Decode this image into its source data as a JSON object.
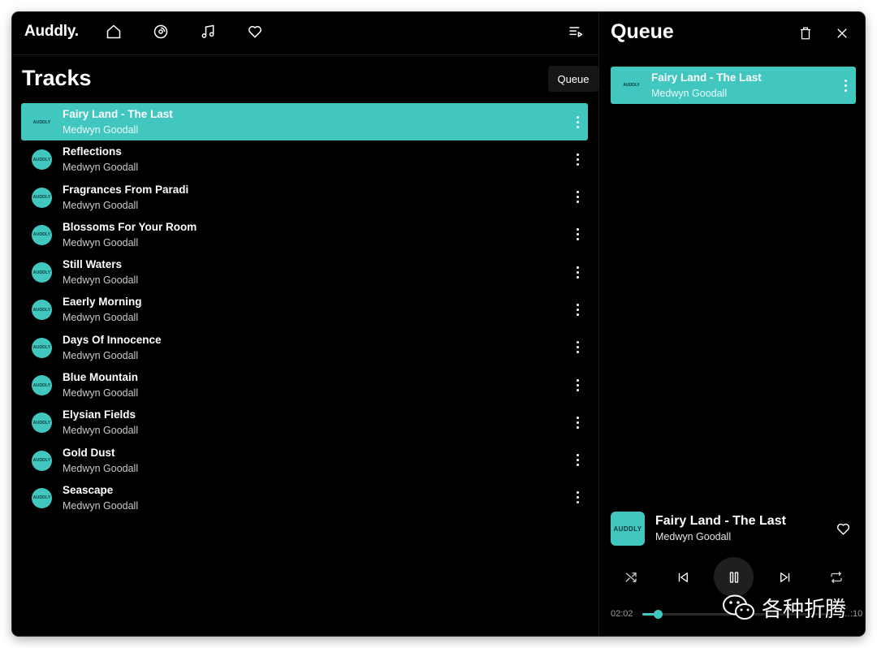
{
  "app": {
    "logo": "Auddly.",
    "accent_color": "#41c6c0",
    "nav": [
      {
        "name": "home",
        "icon": "home-icon"
      },
      {
        "name": "albums",
        "icon": "disc-icon"
      },
      {
        "name": "tracks",
        "icon": "music-note-icon"
      },
      {
        "name": "favorites",
        "icon": "heart-icon"
      }
    ],
    "queue_toggle_icon": "queue-list-icon",
    "tooltip": "Queue"
  },
  "tracks_page": {
    "title": "Tracks",
    "art_label": "AUDDLY",
    "items": [
      {
        "title": "Fairy Land - The Last",
        "artist": "Medwyn Goodall",
        "active": true
      },
      {
        "title": "Reflections",
        "artist": "Medwyn Goodall"
      },
      {
        "title": "Fragrances From Paradi",
        "artist": "Medwyn Goodall"
      },
      {
        "title": "Blossoms For Your Room",
        "artist": "Medwyn Goodall"
      },
      {
        "title": "Still Waters",
        "artist": "Medwyn Goodall"
      },
      {
        "title": "Eaerly Morning",
        "artist": "Medwyn Goodall"
      },
      {
        "title": "Days Of Innocence",
        "artist": "Medwyn Goodall"
      },
      {
        "title": "Blue Mountain",
        "artist": "Medwyn Goodall"
      },
      {
        "title": "Elysian Fields",
        "artist": "Medwyn Goodall"
      },
      {
        "title": "Gold Dust",
        "artist": "Medwyn Goodall"
      },
      {
        "title": "Seascape",
        "artist": "Medwyn Goodall"
      }
    ]
  },
  "queue": {
    "title": "Queue",
    "clear_icon": "trash-icon",
    "close_icon": "close-icon",
    "items": [
      {
        "title": "Fairy Land - The Last",
        "artist": "Medwyn Goodall",
        "art_label": "AUDDLY"
      }
    ]
  },
  "now_playing": {
    "art_label": "AUDDLY",
    "title": "Fairy Land - The Last",
    "artist": "Medwyn Goodall",
    "current_time": "02:02",
    "total_time": "…:10",
    "progress": 0.08,
    "state": "playing"
  },
  "watermark": {
    "text": "各种折腾",
    "icon": "wechat-icon"
  }
}
